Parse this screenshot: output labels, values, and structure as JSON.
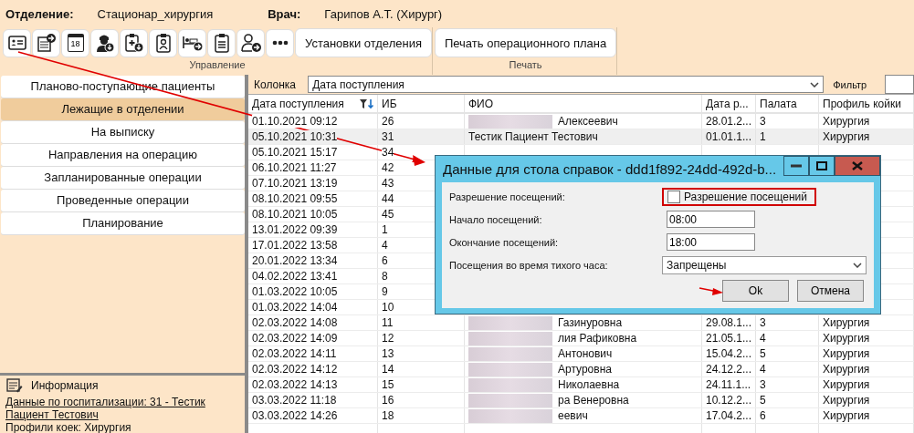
{
  "header": {
    "department_label": "Отделение:",
    "department": "Стационар_хирургия",
    "doctor_label": "Врач:",
    "doctor": "Гарипов А.Т. (Хирург)"
  },
  "toolbar": {
    "icon_buttons": [
      {
        "kind": "id-card"
      },
      {
        "kind": "doc-arrow"
      },
      {
        "kind": "calendar",
        "text": "18"
      },
      {
        "kind": "doctor-down"
      },
      {
        "kind": "clipboard-down"
      },
      {
        "kind": "badge"
      },
      {
        "kind": "bed-arrow"
      },
      {
        "kind": "clipboard"
      },
      {
        "kind": "person-arrow"
      },
      {
        "kind": "more"
      }
    ],
    "text_buttons": [
      "Установки отделения",
      "Печать операционного плана"
    ],
    "groups": [
      "Управление",
      "Печать"
    ]
  },
  "sidebar": {
    "items": [
      {
        "label": "Планово-поступающие пациенты",
        "selected": false
      },
      {
        "label": "Лежащие в отделении",
        "selected": true
      },
      {
        "label": "На выписку",
        "selected": false
      },
      {
        "label": "Направления на операцию",
        "selected": false
      },
      {
        "label": "Запланированные операции",
        "selected": false
      },
      {
        "label": "Проведенные операции",
        "selected": false
      },
      {
        "label": "Планирование",
        "selected": false
      }
    ],
    "info": {
      "title": "Информация",
      "link": "Данные по госпитализации: 31 - Тестик Пациент Тестович",
      "line": "Профили коек: Хирургия"
    }
  },
  "filter": {
    "column_label": "Колонка",
    "column_value": "Дата поступления",
    "filter_label": "Фильтр"
  },
  "table": {
    "columns": [
      "Дата поступления",
      "ИБ",
      "ФИО",
      "Дата р...",
      "Палата",
      "Профиль койки"
    ],
    "rows": [
      {
        "date": "01.10.2021 09:12",
        "ib": "26",
        "fio": "Алексеевич",
        "birth": "28.01.2...",
        "ward": "3",
        "profile": "Хирургия",
        "redacted": true,
        "selected": false
      },
      {
        "date": "05.10.2021 10:31",
        "ib": "31",
        "fio": "Тестик Пациент Тестович",
        "birth": "01.01.1...",
        "ward": "1",
        "profile": "Хирургия",
        "redacted": false,
        "selected": true
      },
      {
        "date": "05.10.2021 15:17",
        "ib": "34",
        "redacted": false,
        "selected": false
      },
      {
        "date": "06.10.2021 11:27",
        "ib": "42",
        "redacted": false,
        "selected": false
      },
      {
        "date": "07.10.2021 13:19",
        "ib": "43",
        "redacted": false,
        "selected": false
      },
      {
        "date": "08.10.2021 09:55",
        "ib": "44",
        "redacted": false,
        "selected": false
      },
      {
        "date": "08.10.2021 10:05",
        "ib": "45",
        "redacted": false,
        "selected": false
      },
      {
        "date": "13.01.2022 09:39",
        "ib": "1",
        "redacted": false,
        "selected": false
      },
      {
        "date": "17.01.2022 13:58",
        "ib": "4",
        "redacted": false,
        "selected": false
      },
      {
        "date": "20.01.2022 13:34",
        "ib": "6",
        "redacted": false,
        "selected": false
      },
      {
        "date": "04.02.2022 13:41",
        "ib": "8",
        "redacted": false,
        "selected": false
      },
      {
        "date": "01.03.2022 10:05",
        "ib": "9",
        "redacted": false,
        "selected": false
      },
      {
        "date": "01.03.2022 14:04",
        "ib": "10",
        "redacted": false,
        "selected": false
      },
      {
        "date": "02.03.2022 14:08",
        "ib": "11",
        "fio": "Газинуровна",
        "birth": "29.08.1...",
        "ward": "3",
        "profile": "Хирургия",
        "redacted": true,
        "selected": false
      },
      {
        "date": "02.03.2022 14:09",
        "ib": "12",
        "fio": "лия Рафиковна",
        "birth": "21.05.1...",
        "ward": "4",
        "profile": "Хирургия",
        "redacted": true,
        "selected": false
      },
      {
        "date": "02.03.2022 14:11",
        "ib": "13",
        "fio": "Антонович",
        "birth": "15.04.2...",
        "ward": "5",
        "profile": "Хирургия",
        "redacted": true,
        "selected": false
      },
      {
        "date": "02.03.2022 14:12",
        "ib": "14",
        "fio": "Артуровна",
        "birth": "24.12.2...",
        "ward": "4",
        "profile": "Хирургия",
        "redacted": true,
        "selected": false
      },
      {
        "date": "02.03.2022 14:13",
        "ib": "15",
        "fio": "Николаевна",
        "birth": "24.11.1...",
        "ward": "3",
        "profile": "Хирургия",
        "redacted": true,
        "selected": false
      },
      {
        "date": "03.03.2022 11:18",
        "ib": "16",
        "fio": "ра Венеровна",
        "birth": "10.12.2...",
        "ward": "5",
        "profile": "Хирургия",
        "redacted": true,
        "selected": false
      },
      {
        "date": "03.03.2022 14:26",
        "ib": "18",
        "fio": "еевич",
        "birth": "17.04.2...",
        "ward": "6",
        "profile": "Хирургия",
        "redacted": true,
        "selected": false
      }
    ]
  },
  "dialog": {
    "title": "Данные для стола справок - ddd1f892-24dd-492d-b...",
    "visits_label": "Разрешение посещений:",
    "visits_checkbox": "Разрешение посещений",
    "visits_checked": false,
    "start_label": "Начало посещений:",
    "start": "08:00",
    "end_label": "Окончание посещений:",
    "end": "18:00",
    "quiet_label": "Посещения во время тихого часа:",
    "quiet": "Запрещены",
    "buttons": [
      "Ok",
      "Отмена"
    ]
  }
}
